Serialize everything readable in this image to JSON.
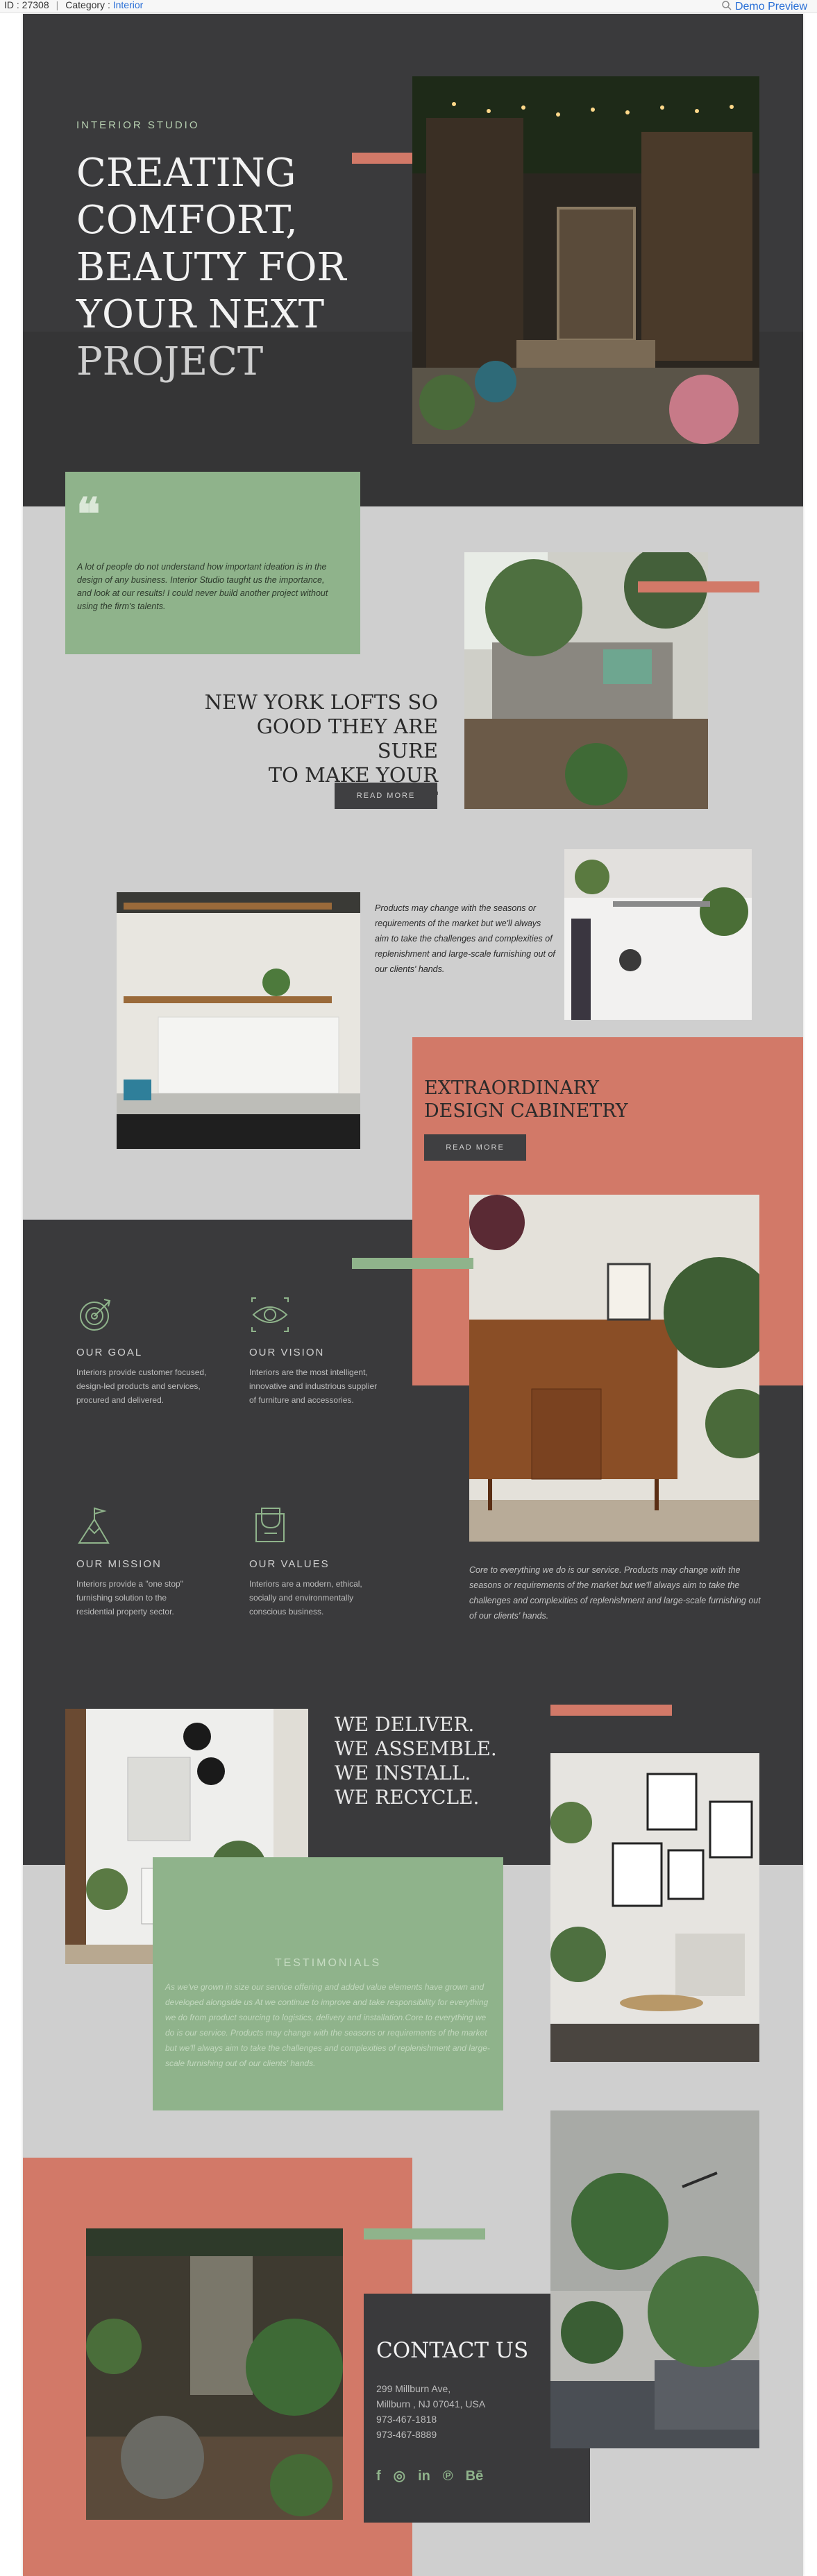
{
  "topbar": {
    "id_text": "ID : 27308",
    "category_label": "Category :",
    "category_value": "Interior",
    "demo_label": "Demo Preview"
  },
  "hero": {
    "kicker": "INTERIOR STUDIO",
    "title_lines": [
      "CREATING",
      "COMFORT,",
      "BEAUTY FOR",
      "YOUR NEXT",
      "PROJECT"
    ]
  },
  "quote": {
    "text": "A lot of people do not understand how important ideation is in the design of any business. Interior Studio taught us the importance, and look at our results! I could never build another project without using the firm's talents."
  },
  "lofts": {
    "title_lines": [
      "NEW YORK LOFTS SO",
      "GOOD THEY ARE SURE",
      "TO MAKE YOUR HEART"
    ],
    "button": "READ MORE"
  },
  "products": {
    "text": "Products may change with the seasons or requirements of the market but we'll always aim to take the challenges and complexities of replenishment and large-scale furnishing out of our clients' hands."
  },
  "cabinetry": {
    "title_lines": [
      "EXTRAORDINARY",
      "DESIGN CABINETRY"
    ],
    "button": "READ MORE"
  },
  "pillars": [
    {
      "icon": "target-icon",
      "title": "OUR GOAL",
      "text_lines": [
        "Interiors provide customer focused,",
        "design-led products and services,",
        "procured and delivered."
      ]
    },
    {
      "icon": "eye-icon",
      "title": "OUR VISION",
      "text_lines": [
        "Interiors are the most intelligent,",
        "innovative and industrious supplier",
        "of furniture and accessories."
      ]
    },
    {
      "icon": "mountain-flag-icon",
      "title": "OUR MISSION",
      "text_lines": [
        "Interiors provide a \"one stop\"",
        "furnishing solution to the",
        "residential property sector."
      ]
    },
    {
      "icon": "trophy-icon",
      "title": "OUR VALUES",
      "text_lines": [
        "Interiors are a modern, ethical,",
        "socially and environmentally",
        "conscious business."
      ]
    }
  ],
  "core": {
    "text": "Core to everything we do is our service. Products may change with the seasons or requirements of the market but we'll always aim to take the challenges and complexities of replenishment and large-scale furnishing out of our clients' hands."
  },
  "deliver": {
    "lines": [
      "WE DELIVER.",
      "WE ASSEMBLE.",
      "WE INSTALL.",
      "WE RECYCLE."
    ]
  },
  "testimonials": {
    "title": "TESTIMONIALS",
    "text": "As we've grown in size our service offering and added value elements have grown and developed alongside us At we continue to improve and take responsibility for everything we do from product sourcing to logistics, delivery and installation.Core to everything we do is our service. Products may change with the seasons or requirements of the market but we'll always aim to take the challenges and complexities of replenishment and large-scale furnishing out of our clients' hands."
  },
  "contact": {
    "title": "CONTACT US",
    "address1": "299 Millburn Ave,",
    "address2": "Millburn , NJ 07041, USA",
    "phone1": "973-467-1818",
    "phone2": "973-467-8889",
    "social": [
      "f",
      "◎",
      "in",
      "℗",
      "Bē"
    ]
  },
  "colors": {
    "dark": "#3a3a3c",
    "green": "#8fb38b",
    "salmon": "#d27968",
    "background": "#cfcfcf"
  }
}
